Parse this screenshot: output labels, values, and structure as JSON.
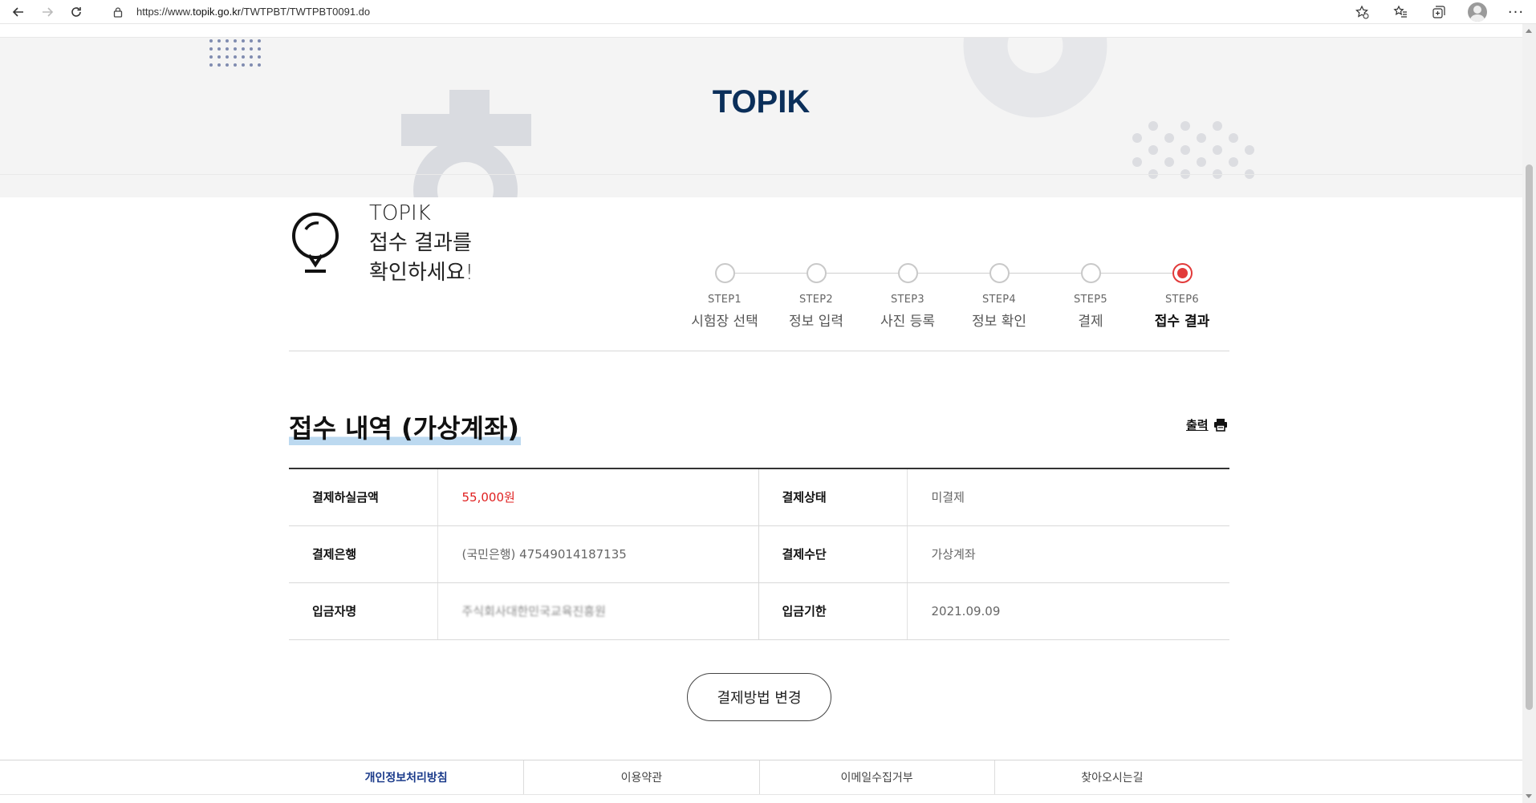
{
  "browser": {
    "url_prefix": "https://www.",
    "url_host": "topik.go.kr",
    "url_path": "/TWTPBT/TWTPBT0091.do"
  },
  "hero": {
    "title": "TOPIK"
  },
  "intro": {
    "line1": "TOPIK",
    "line2": "접수 결과를",
    "line3": "확인하세요!"
  },
  "steps": [
    {
      "num": "STEP1",
      "name": "시험장 선택"
    },
    {
      "num": "STEP2",
      "name": "정보 입력"
    },
    {
      "num": "STEP3",
      "name": "사진 등록"
    },
    {
      "num": "STEP4",
      "name": "정보 확인"
    },
    {
      "num": "STEP5",
      "name": "결제"
    },
    {
      "num": "STEP6",
      "name": "접수 결과"
    }
  ],
  "active_step": "STEP6",
  "section": {
    "title": "접수 내역 (가상계좌)",
    "print_label": "출력"
  },
  "table": {
    "rows": [
      {
        "label1": "결제하실금액",
        "value1": "55,000원",
        "label2": "결제상태",
        "value2": "미결제"
      },
      {
        "label1": "결제은행",
        "value1": "(국민은행) 47549014187135",
        "label2": "결제수단",
        "value2": "가상계좌"
      },
      {
        "label1": "입금자명",
        "value1": "주식회사대한민국교육진흥원",
        "label2": "입금기한",
        "value2": "2021.09.09"
      }
    ]
  },
  "change_button": "결제방법 변경",
  "footer": {
    "links": [
      "개인정보처리방침",
      "이용약관",
      "이메일수집거부",
      "찾아오시는길"
    ]
  },
  "colors": {
    "title_navy": "#0b2f5a",
    "active_red": "#e23a3a",
    "amount_red": "#e02020",
    "highlight_blue": "#bcd9f0",
    "footer_primary": "#1a3a8a"
  }
}
